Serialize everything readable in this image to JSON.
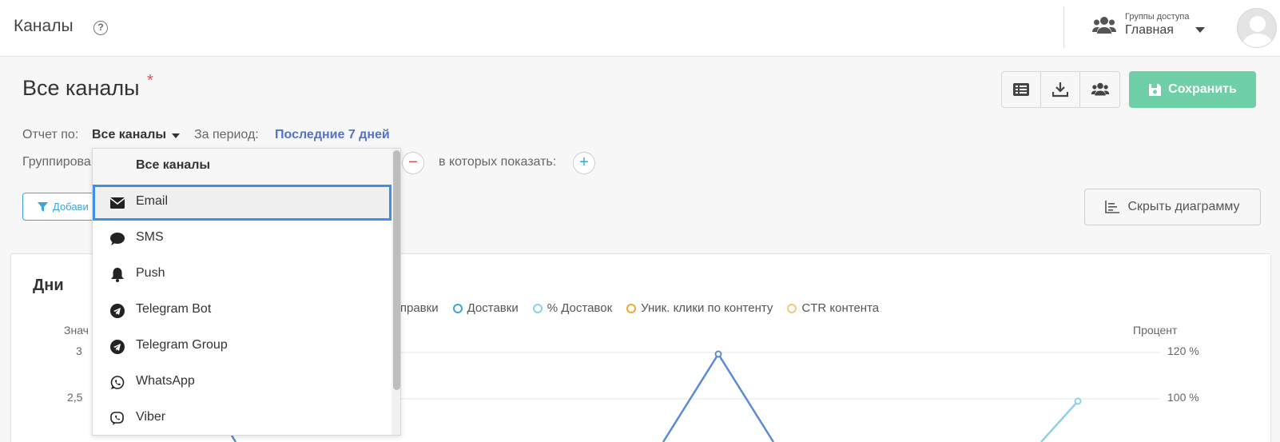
{
  "topbar": {
    "title": "Каналы",
    "help": "?",
    "access_groups_caption": "Группы доступа",
    "access_groups_value": "Главная"
  },
  "report": {
    "title": "Все каналы",
    "unsaved_marker": "*",
    "save_label": "Сохранить",
    "toolbar_icons": [
      "list-icon",
      "download-icon",
      "users-icon"
    ],
    "report_by_label": "Отчет по:",
    "report_by_value": "Все каналы",
    "period_label": "За период:",
    "period_value": "Последние 7 дней",
    "grouping_label": "Группирова",
    "show_in_label": "в которых показать:",
    "remove": "−",
    "add": "+",
    "filter_label": "Добави",
    "hide_chart_label": "Скрыть диаграмму"
  },
  "chart": {
    "title": "Дни",
    "left_axis_label": "Знач",
    "right_axis_label": "Процент",
    "left_ticks": [
      "3",
      "2,5"
    ],
    "right_ticks": [
      "120 %",
      "100 %"
    ],
    "legend": [
      {
        "label": "тправки",
        "color": "#5b8ad6"
      },
      {
        "label": "Доставки",
        "color": "#3aa5d8"
      },
      {
        "label": "% Доставок",
        "color": "#8fd0ea"
      },
      {
        "label": "Уник. клики по контенту",
        "color": "#f0a830"
      },
      {
        "label": "CTR контента",
        "color": "#f6c77a"
      }
    ]
  },
  "dropdown": {
    "items": [
      {
        "label": "Все каналы",
        "icon": ""
      },
      {
        "label": "Email",
        "icon": "envelope-icon"
      },
      {
        "label": "SMS",
        "icon": "chat-bubble-icon"
      },
      {
        "label": "Push",
        "icon": "bell-icon"
      },
      {
        "label": "Telegram Bot",
        "icon": "telegram-icon"
      },
      {
        "label": "Telegram Group",
        "icon": "telegram-icon"
      },
      {
        "label": "WhatsApp",
        "icon": "whatsapp-icon"
      },
      {
        "label": "Viber",
        "icon": "viber-icon"
      }
    ],
    "selected": "Email"
  }
}
